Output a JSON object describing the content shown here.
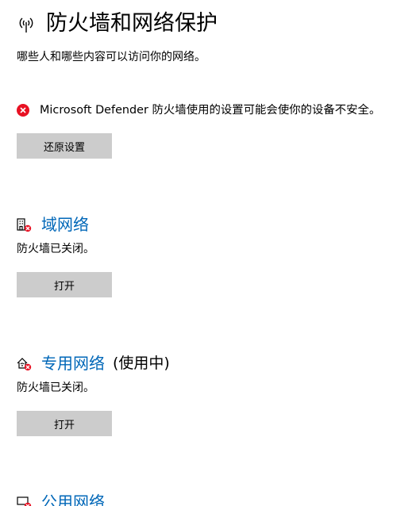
{
  "header": {
    "title": "防火墙和网络保护",
    "subtitle": "哪些人和哪些内容可以访问你的网络。"
  },
  "warning": {
    "text": "Microsoft Defender 防火墙使用的设置可能会使你的设备不安全。",
    "button_label": "还原设置"
  },
  "networks": [
    {
      "name": "域网络",
      "suffix": "",
      "status": "防火墙已关闭。",
      "button_label": "打开"
    },
    {
      "name": "专用网络",
      "suffix": "(使用中)",
      "status": "防火墙已关闭。",
      "button_label": "打开"
    },
    {
      "name": "公用网络"
    }
  ],
  "colors": {
    "link": "#0067b8",
    "error": "#e81123",
    "button_bg": "#cccccc"
  }
}
